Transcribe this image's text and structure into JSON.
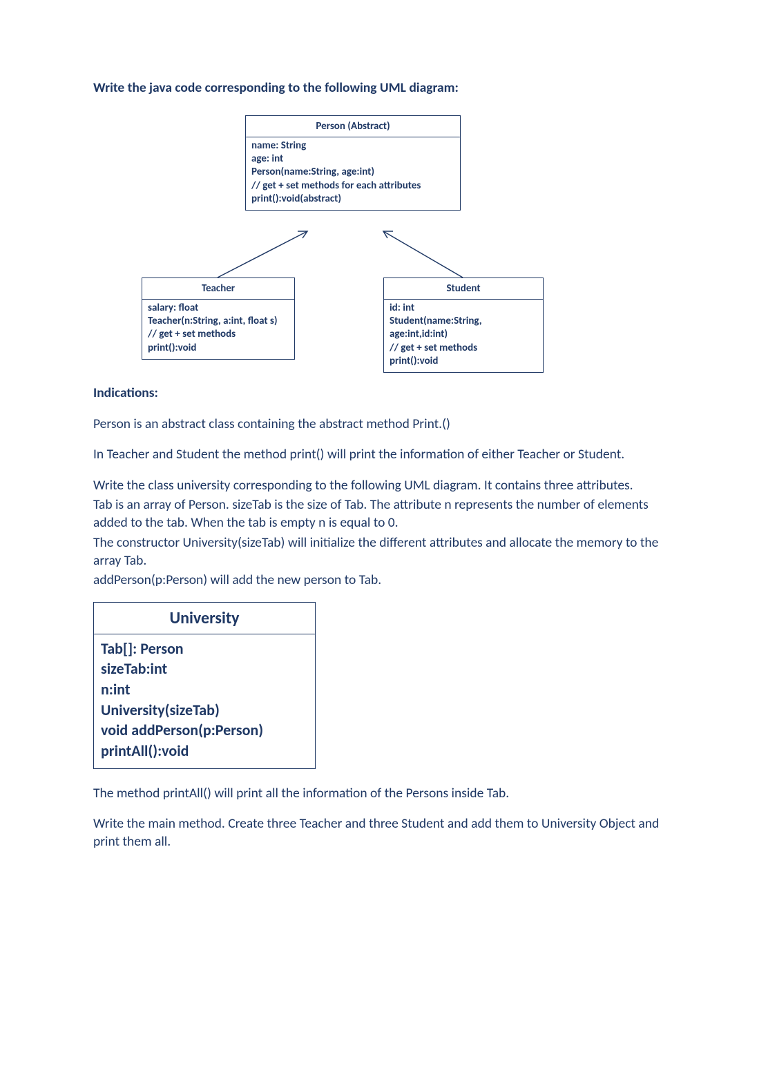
{
  "intro": "Write the java code corresponding to the following UML diagram:",
  "person": {
    "title": "Person (Abstract)",
    "lines": [
      "name: String",
      "age: int",
      "Person(name:String, age:int)",
      "// get + set methods for each attributes",
      "print():void(abstract)"
    ]
  },
  "teacher": {
    "title": "Teacher",
    "lines": [
      "salary: float",
      "Teacher(n:String, a:int, float s)",
      "// get + set methods",
      "print():void"
    ]
  },
  "student": {
    "title": "Student",
    "lines": [
      "id: int",
      "Student(name:String, age:int,id:int)",
      "// get + set methods",
      "print():void"
    ]
  },
  "indications_h": "Indications:",
  "p1": "Person is an abstract class containing the abstract method Print.()",
  "p2": "In Teacher and Student the method print() will print the information of either Teacher or Student.",
  "p3a": "Write the class university corresponding to the following UML diagram. It contains three attributes.",
  "p3b_1": "Tab",
  "p3b_2": " is an array of Person. ",
  "p3b_3": "sizeTab",
  "p3b_4": " is the size of ",
  "p3b_5": "Tab",
  "p3b_6": ". The attribute ",
  "p3b_7": "n",
  "p3b_8": " represents the number of elements added to the tab. When the tab is empty ",
  "p3b_9": "n",
  "p3b_10": " is equal to 0.",
  "p3c": "The constructor University(sizeTab) will initialize the different attributes and allocate the memory to the array Tab.",
  "p3d_1": "addPerson(p:Person)",
  "p3d_2": " will add the new person to Tab.",
  "university": {
    "title": "University",
    "lines": [
      "Tab[]: Person",
      "sizeTab:int",
      "n:int",
      "University(sizeTab)",
      "void addPerson(p:Person)",
      "printAll():void"
    ]
  },
  "p4": "The method printAll() will print all the information of the Persons inside Tab.",
  "p5": "Write the main method. Create three Teacher and three Student and add them to University Object and print them all."
}
